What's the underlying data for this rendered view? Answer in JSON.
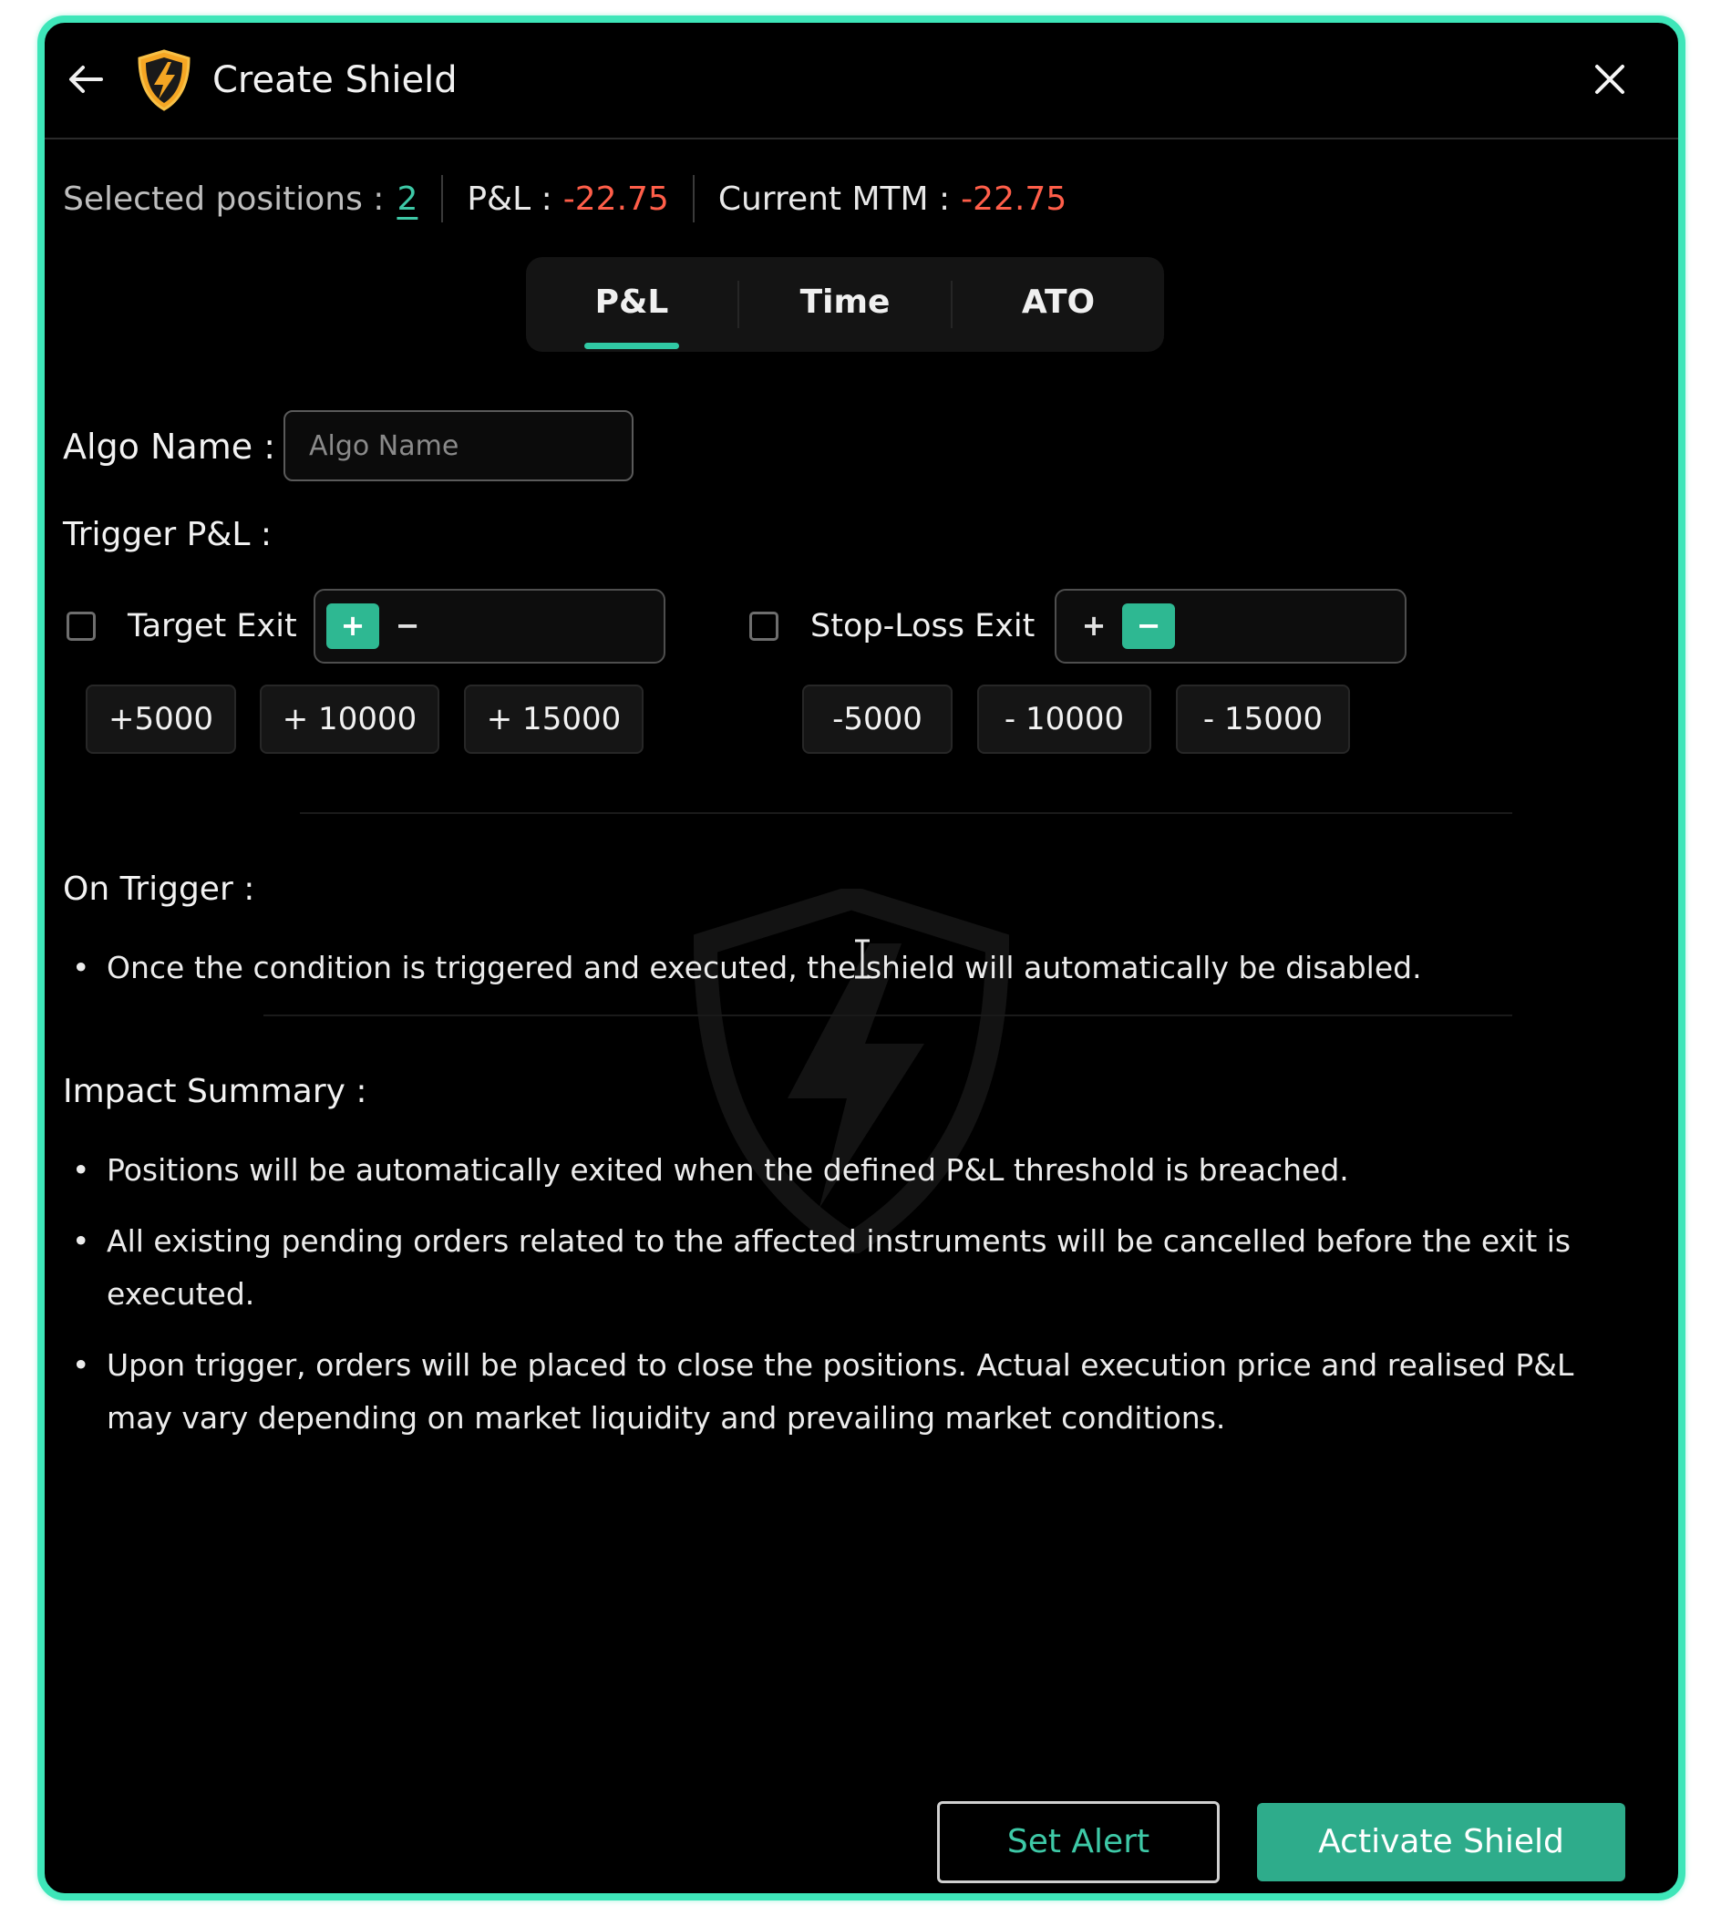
{
  "header": {
    "title": "Create Shield",
    "back_icon": "arrow-left-icon",
    "close_icon": "close-icon",
    "logo_icon": "shield-lightning-icon"
  },
  "summary": {
    "selected_label": "Selected positions :",
    "selected_value": "2",
    "pnl_label": "P&L :",
    "pnl_value": "-22.75",
    "mtm_label": "Current MTM :",
    "mtm_value": "-22.75"
  },
  "tabs": [
    {
      "label": "P&L",
      "active": true
    },
    {
      "label": "Time",
      "active": false
    },
    {
      "label": "ATO",
      "active": false
    }
  ],
  "algo": {
    "label": "Algo Name :",
    "placeholder": "Algo Name",
    "value": ""
  },
  "trigger": {
    "label": "Trigger P&L :",
    "target": {
      "label": "Target Exit",
      "checked": false,
      "plus": "+",
      "minus": "−",
      "selected_sign": "plus",
      "value": "",
      "quick": [
        "+5000",
        "+ 10000",
        "+ 15000"
      ]
    },
    "stoploss": {
      "label": "Stop-Loss Exit",
      "checked": false,
      "plus": "+",
      "minus": "−",
      "selected_sign": "minus",
      "value": "",
      "quick": [
        "-5000",
        "- 10000",
        "- 15000"
      ]
    }
  },
  "on_trigger": {
    "heading": "On Trigger :",
    "items": [
      "Once the condition is triggered and executed, the shield will automatically be disabled."
    ]
  },
  "impact": {
    "heading": "Impact Summary :",
    "items": [
      "Positions will be automatically exited when the defined P&L threshold is breached.",
      "All existing pending orders related to the affected instruments will be cancelled before the exit is executed.",
      "Upon trigger, orders will be placed to close the positions. Actual execution price and realised P&L may vary depending on market liquidity and prevailing market conditions."
    ]
  },
  "footer": {
    "set_alert": "Set Alert",
    "activate": "Activate Shield"
  },
  "colors": {
    "accent": "#3ee6b9",
    "button_green": "#2eac8b",
    "negative": "#ff5e49",
    "link_teal": "#3ec9a7"
  }
}
